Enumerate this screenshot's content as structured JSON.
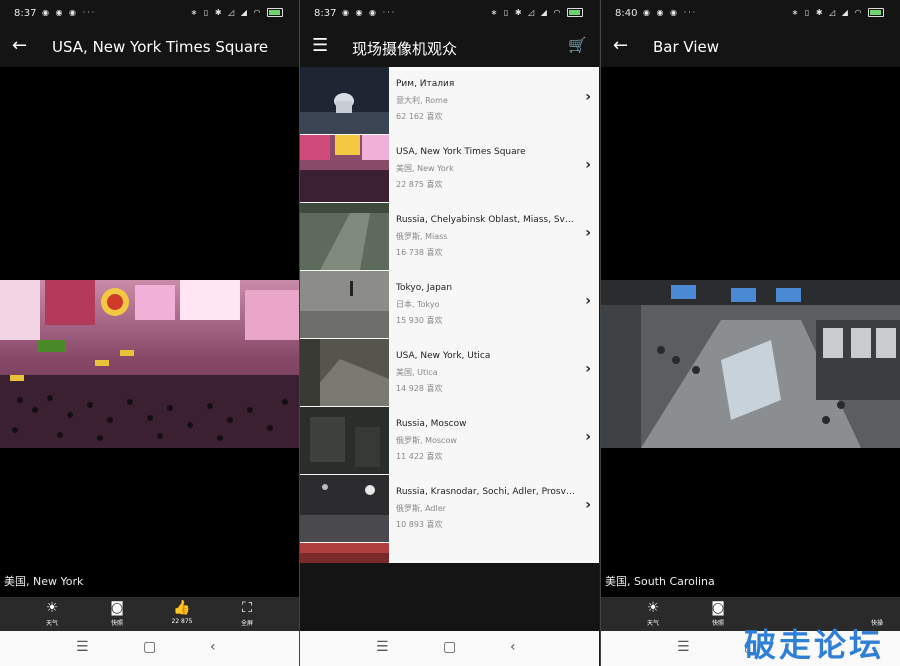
{
  "panel1": {
    "status": {
      "time": "8:37",
      "notif": "◉ ◉ ◉ ···",
      "sys": "∗ ▯ ✱ ◿ ◢ ◠"
    },
    "title": "USA, New York Times Square",
    "location": "美国, New York",
    "controls": [
      {
        "icon": "☀",
        "label": "天气"
      },
      {
        "icon": "◙",
        "label": "快照"
      },
      {
        "icon": "👍",
        "label": "22 875"
      },
      {
        "icon": "⛶",
        "label": "全屏"
      }
    ]
  },
  "panel2": {
    "status": {
      "time": "8:37",
      "notif": "◉ ◉ ◉ ···",
      "sys": "∗ ▯ ✱ ◿ ◢ ◠"
    },
    "title": "现场摄像机观众",
    "items": [
      {
        "title": "Рим, Италия",
        "sub": "意大利, Rome",
        "likes": "62 162 喜欢"
      },
      {
        "title": "USA, New York Times Square",
        "sub": "美国, New York",
        "likes": "22 875 喜欢"
      },
      {
        "title": "Russia, Chelyabinsk Oblast, Miass, Sve...",
        "sub": "俄罗斯, Miass",
        "likes": "16 738 喜欢"
      },
      {
        "title": "Tokyo, Japan",
        "sub": "日本, Tokyo",
        "likes": "15 930 喜欢"
      },
      {
        "title": "USA, New York, Utica",
        "sub": "美国, Utica",
        "likes": "14 928 喜欢"
      },
      {
        "title": "Russia, Moscow",
        "sub": "俄罗斯, Moscow",
        "likes": "11 422 喜欢"
      },
      {
        "title": "Russia, Krasnodar, Sochi, Adler, Prosve...",
        "sub": "俄罗斯, Adler",
        "likes": "10 893 喜欢"
      },
      {
        "title": "",
        "sub": "",
        "likes": ""
      }
    ]
  },
  "panel3": {
    "status": {
      "time": "8:40",
      "notif": "◉ ◉ ◉ ···",
      "sys": "∗ ▯ ✱ ◿ ◢ ◠"
    },
    "title": "Bar View",
    "location": "美国, South Carolina",
    "controls": [
      {
        "icon": "☀",
        "label": "天气"
      },
      {
        "icon": "◙",
        "label": "快照"
      },
      {
        "icon": "",
        "label": ""
      },
      {
        "icon": "",
        "label": "快操"
      }
    ]
  },
  "navbar": {
    "menu": "☰",
    "home": "▢",
    "back": "‹"
  },
  "watermark": "破走论坛"
}
